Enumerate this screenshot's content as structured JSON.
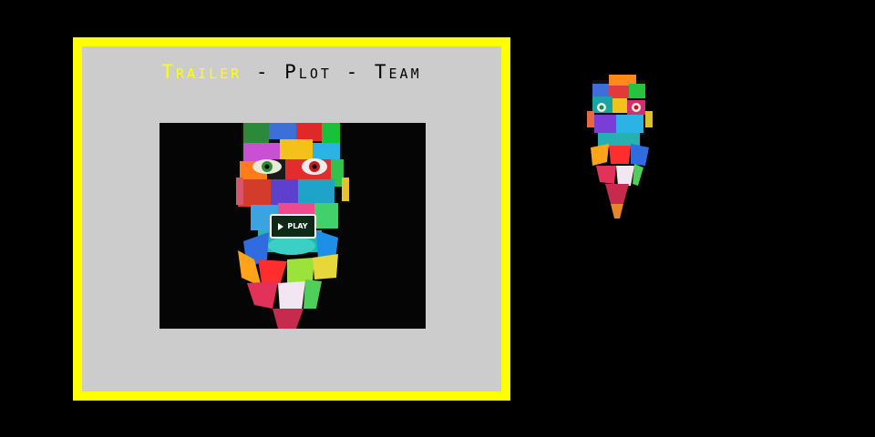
{
  "nav": {
    "items": [
      {
        "label": "Trailer",
        "active": true
      },
      {
        "label": "Plot",
        "active": false
      },
      {
        "label": "Team",
        "active": false
      }
    ],
    "separator": "-"
  },
  "player": {
    "play_label": "PLAY"
  },
  "colors": {
    "frame": "#ffff00",
    "panel": "#cccccc",
    "background": "#000000",
    "active_nav": "#ffff00"
  },
  "icons": {
    "play": "play-triangle-icon"
  }
}
